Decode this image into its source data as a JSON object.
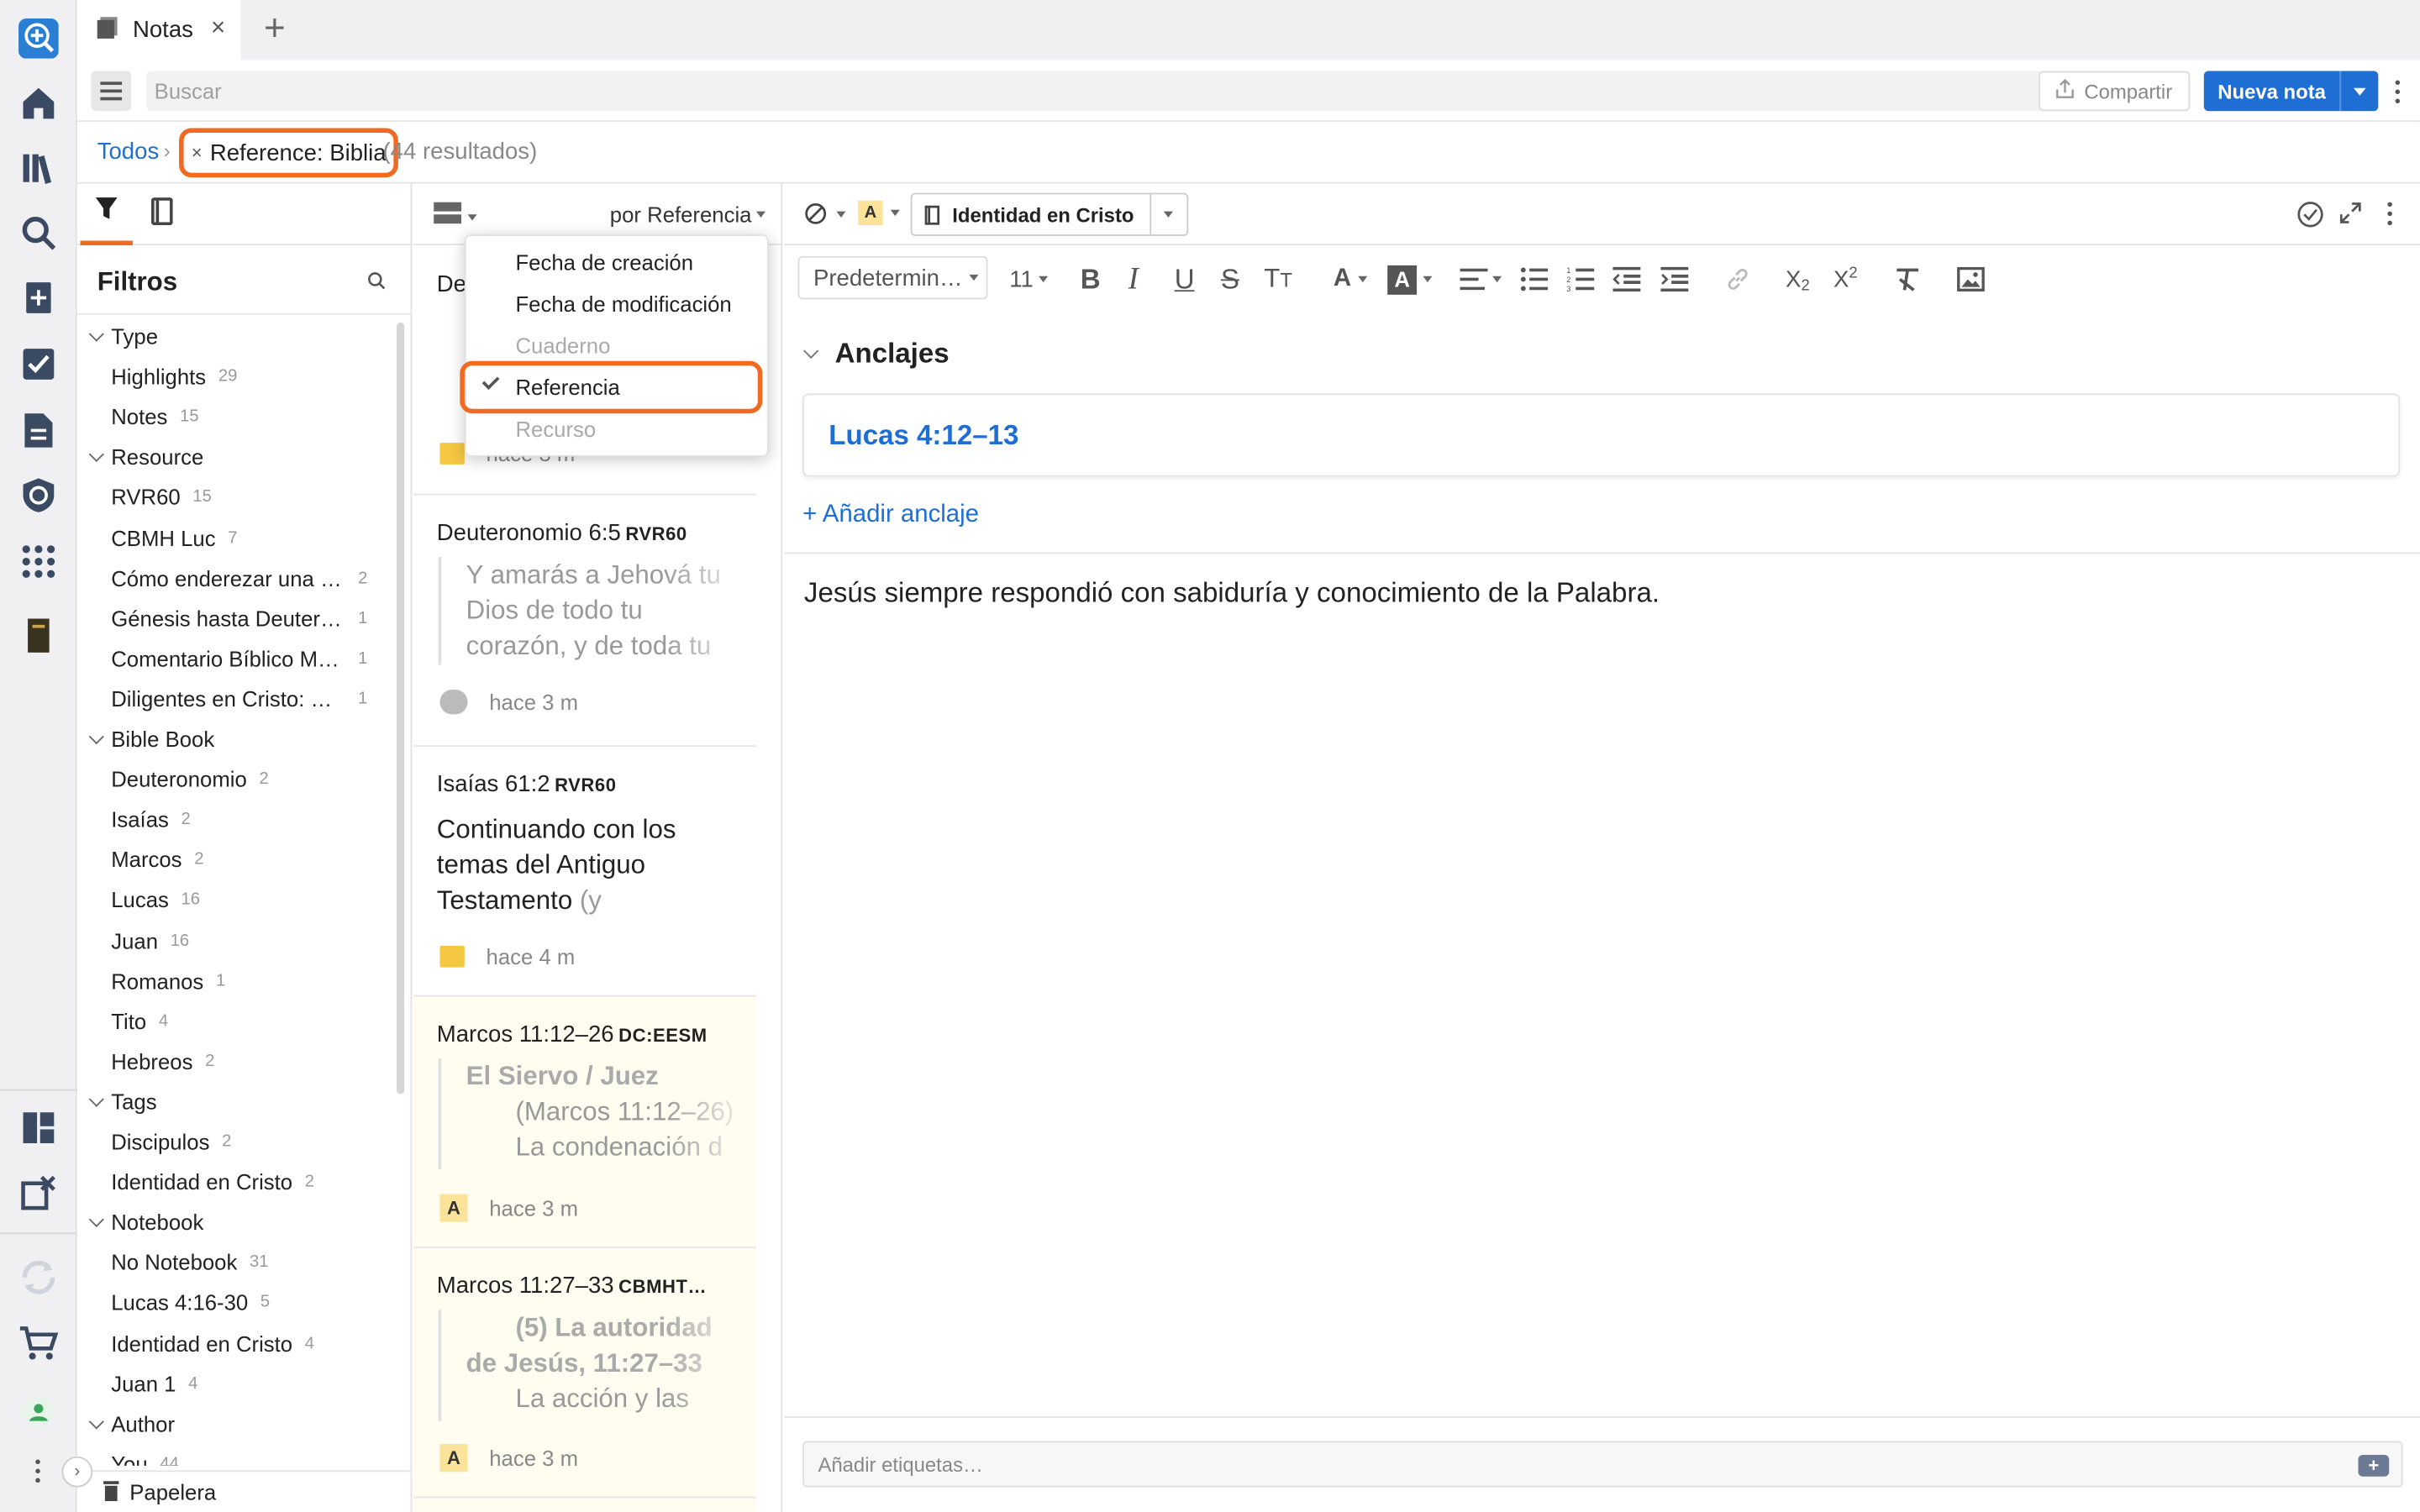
{
  "tab": {
    "title": "Notas",
    "close": "×",
    "add": "+"
  },
  "toolbar": {
    "search_placeholder": "Buscar",
    "share_label": "Compartir",
    "new_note_label": "Nueva nota"
  },
  "breadcrumb": {
    "all": "Todos",
    "separator": "›",
    "chip_label": "Reference: Biblia",
    "chip_remove": "×",
    "result_count": "(44 resultados)"
  },
  "filters": {
    "title": "Filtros",
    "trash_label": "Papelera",
    "groups": [
      {
        "label": "Type",
        "items": [
          {
            "label": "Highlights",
            "count": "29"
          },
          {
            "label": "Notes",
            "count": "15"
          }
        ]
      },
      {
        "label": "Resource",
        "items": [
          {
            "label": "RVR60",
            "count": "15"
          },
          {
            "label": "CBMH Luc",
            "count": "7"
          },
          {
            "label": "Cómo enderezar una ig…",
            "count": "2"
          },
          {
            "label": "Génesis hasta Deutero…",
            "count": "1"
          },
          {
            "label": "Comentario Bíblico Mu…",
            "count": "1"
          },
          {
            "label": "Diligentes en Cristo: Est…",
            "count": "1"
          }
        ]
      },
      {
        "label": "Bible Book",
        "items": [
          {
            "label": "Deuteronomio",
            "count": "2"
          },
          {
            "label": "Isaías",
            "count": "2"
          },
          {
            "label": "Marcos",
            "count": "2"
          },
          {
            "label": "Lucas",
            "count": "16"
          },
          {
            "label": "Juan",
            "count": "16"
          },
          {
            "label": "Romanos",
            "count": "1"
          },
          {
            "label": "Tito",
            "count": "4"
          },
          {
            "label": "Hebreos",
            "count": "2"
          }
        ]
      },
      {
        "label": "Tags",
        "items": [
          {
            "label": "Discipulos",
            "count": "2"
          },
          {
            "label": "Identidad en Cristo",
            "count": "2"
          }
        ]
      },
      {
        "label": "Notebook",
        "items": [
          {
            "label": "No Notebook",
            "count": "31"
          },
          {
            "label": "Lucas 4:16-30",
            "count": "5"
          },
          {
            "label": "Identidad en Cristo",
            "count": "4"
          },
          {
            "label": "Juan 1",
            "count": "4"
          }
        ]
      },
      {
        "label": "Author",
        "items": [
          {
            "label": "You",
            "count": "44"
          }
        ]
      }
    ]
  },
  "notes_list": {
    "sort_label": "por Referencia",
    "partial_title": "De",
    "partial_time": "hace 3 m",
    "cards": [
      {
        "ref": "Deuteronomio 6:5",
        "resource": "RVR60",
        "quote_lines": [
          "Y amarás a Jehová tu",
          "Dios de todo tu",
          "corazón, y de toda tu"
        ],
        "time": "hace 3 m"
      },
      {
        "ref": "Isaías 61:2",
        "resource": "RVR60",
        "body_lines": [
          "Continuando con los",
          "temas del Antiguo",
          "Testamento"
        ],
        "body_tail": "(y",
        "time": "hace 4 m"
      },
      {
        "ref": "Marcos 11:12–26",
        "resource": "DC:EESM",
        "quote_title": "El Siervo / Juez",
        "quote_lines": [
          "(Marcos 11:12–26)",
          "La condenación d"
        ],
        "time": "hace 3 m"
      },
      {
        "ref": "Marcos 11:27–33",
        "resource": "CBMHT…",
        "quote_title_lines": [
          "(5) La autoridad",
          "de Jesús, 11:27–33"
        ],
        "quote_lines": [
          "La acción y las"
        ],
        "time": "hace 3 m"
      }
    ]
  },
  "sort_menu": {
    "items": [
      {
        "label": "Fecha de creación",
        "enabled": true,
        "checked": false
      },
      {
        "label": "Fecha de modificación",
        "enabled": true,
        "checked": false
      },
      {
        "label": "Cuaderno",
        "enabled": false,
        "checked": false
      },
      {
        "label": "Referencia",
        "enabled": true,
        "checked": true
      },
      {
        "label": "Recurso",
        "enabled": false,
        "checked": false
      }
    ]
  },
  "editor": {
    "notebook": "Identidad en Cristo",
    "style_select": "Predetermin…",
    "font_size": "11",
    "anchors_title": "Anclajes",
    "anchor": "Lucas 4:12–13",
    "add_anchor": "+ Añadir anclaje",
    "body": "Jesús siempre respondió con sabiduría y conocimiento de la Palabra.",
    "tags_placeholder": "Añadir etiquetas…"
  },
  "colors": {
    "accent": "#f26a21",
    "link": "#1f6ed4",
    "primary_button": "#1f6ed4"
  },
  "icons": {
    "rail": [
      "app-logo-icon",
      "home-icon",
      "library-icon",
      "search-icon",
      "add-doc-icon",
      "checklist-icon",
      "document-icon",
      "shield-icon",
      "apps-grid-icon",
      "book-icon",
      "layout-icon",
      "close-panel-icon",
      "sync-icon",
      "cart-icon",
      "user-icon",
      "more-icon"
    ]
  }
}
